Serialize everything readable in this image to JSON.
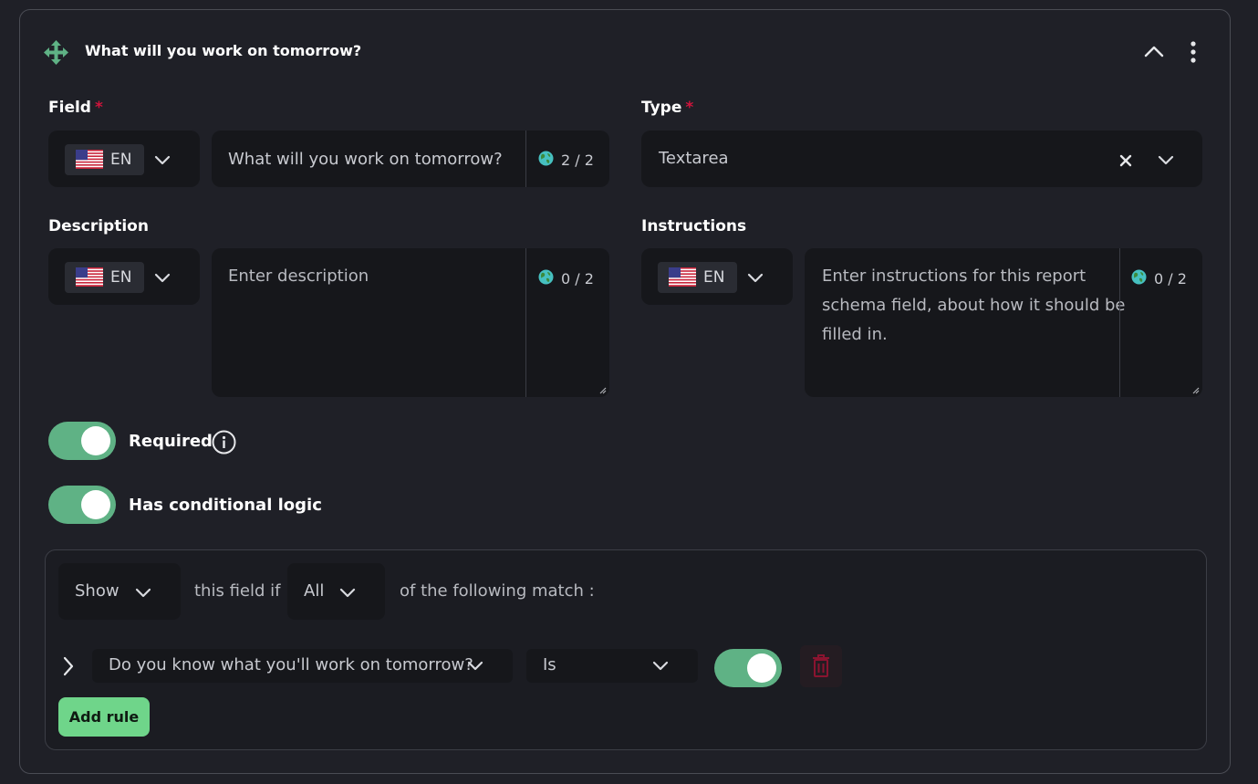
{
  "header": {
    "title": "What will you work on tomorrow?"
  },
  "field": {
    "label": "Field",
    "required_mark": "*",
    "lang_code": "EN",
    "value": "What will you work on tomorrow?",
    "counter": "2 / 2"
  },
  "type": {
    "label": "Type",
    "required_mark": "*",
    "value": "Textarea"
  },
  "description": {
    "label": "Description",
    "lang_code": "EN",
    "placeholder": "Enter description",
    "counter": "0 / 2"
  },
  "instructions": {
    "label": "Instructions",
    "lang_code": "EN",
    "placeholder_line1": "Enter instructions for this report",
    "placeholder_line2": "schema field, about how it should be",
    "placeholder_line3": "filled in.",
    "counter": "0 / 2"
  },
  "toggles": {
    "required": {
      "label": "Required",
      "on": true
    },
    "conditional": {
      "label": "Has conditional logic",
      "on": true
    }
  },
  "logic": {
    "action": "Show",
    "text_mid": "this field if",
    "match": "All",
    "text_end": "of the following match :",
    "rule": {
      "question": "Do you know what you'll work on tomorrow?",
      "operator": "Is",
      "value_on": true
    },
    "add_rule_label": "Add rule"
  },
  "colors": {
    "accent_green": "#5fb285",
    "button_green": "#6fd58a",
    "required_red": "#d0143c",
    "trash_red": "#8a1430"
  },
  "icons": [
    "move-icon",
    "chevron-up-icon",
    "more-vertical-icon",
    "us-flag-icon",
    "chevron-down-icon",
    "globe-icon",
    "clear-icon",
    "info-icon",
    "chevron-right-icon",
    "trash-icon"
  ]
}
